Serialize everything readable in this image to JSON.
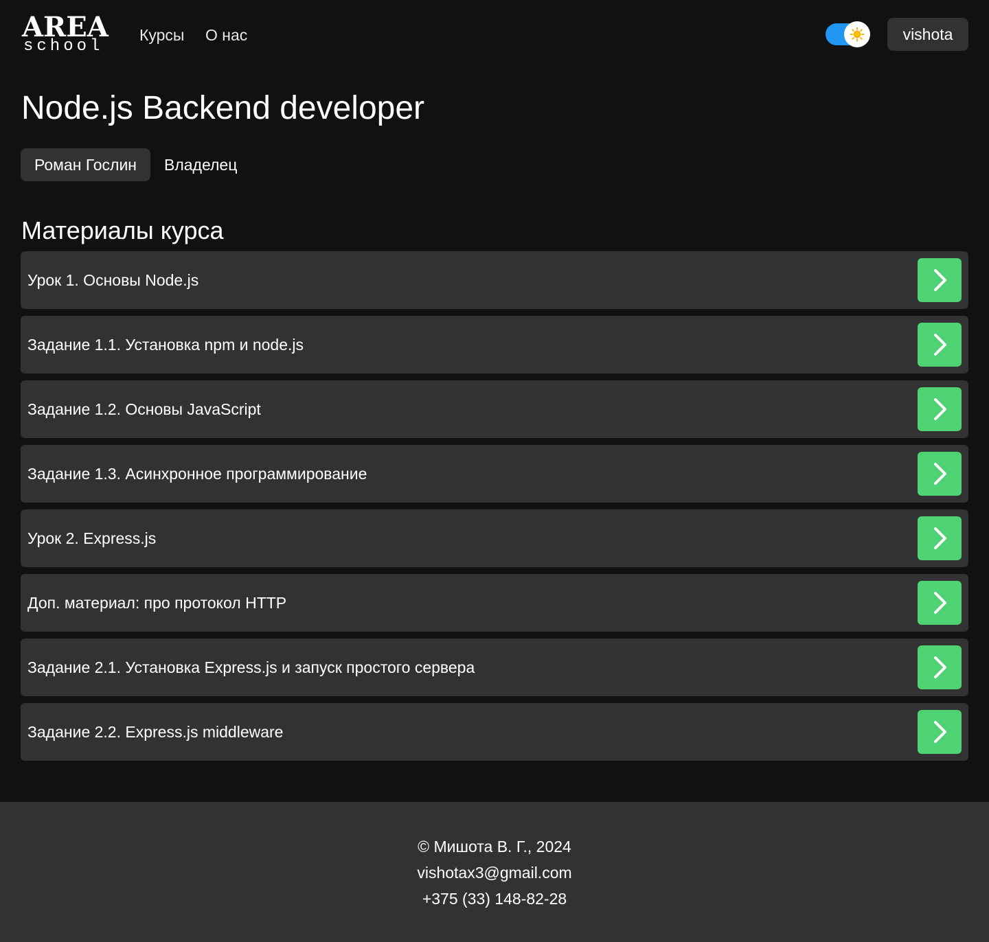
{
  "header": {
    "logo_top": "AREA",
    "logo_bottom": "school",
    "nav": [
      {
        "label": "Курсы"
      },
      {
        "label": "О нас"
      }
    ],
    "theme_toggle": {
      "state": "on",
      "icon": "sun-icon"
    },
    "user": {
      "name": "vishota"
    }
  },
  "course": {
    "title": "Node.js Backend developer",
    "owner_name": "Роман Гослин",
    "owner_role": "Владелец"
  },
  "materials": {
    "title": "Материалы курса",
    "items": [
      {
        "label": "Урок 1. Основы Node.js"
      },
      {
        "label": "Задание 1.1. Установка npm и node.js"
      },
      {
        "label": "Задание 1.2. Основы JavaScript"
      },
      {
        "label": "Задание 1.3. Асинхронное программирование"
      },
      {
        "label": "Урок 2. Express.js"
      },
      {
        "label": "Доп. материал: про протокол HTTP"
      },
      {
        "label": "Задание 2.1. Установка Express.js и запуск простого сервера"
      },
      {
        "label": "Задание 2.2. Express.js middleware"
      }
    ]
  },
  "footer": {
    "copyright": "© Мишота В. Г., 2024",
    "email": "vishotax3@gmail.com",
    "phone": "+375 (33) 148-82-28"
  },
  "colors": {
    "background": "#111111",
    "surface": "#323232",
    "accent_green": "#4fd273",
    "toggle_blue": "#2196f3",
    "text": "#ffffff"
  }
}
